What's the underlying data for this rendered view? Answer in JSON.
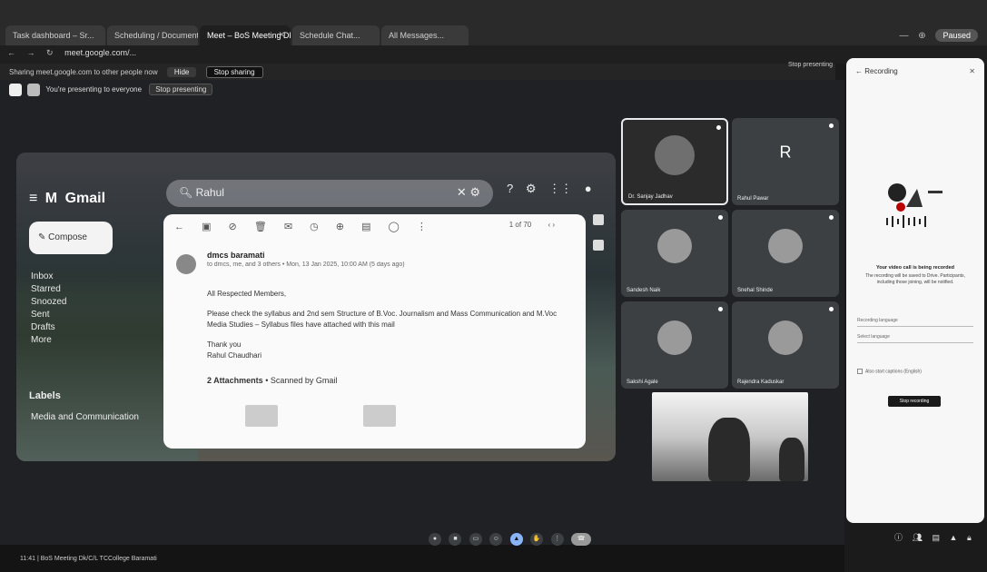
{
  "browser": {
    "tabs": [
      "Task dashboard – Sr...",
      "Scheduling / Documents...",
      "Meet – BoS Meeting Dk...",
      "Schedule Chat...",
      "All Messages..."
    ],
    "profile_label": "Paused",
    "url": "meet.google.com/..."
  },
  "sharebar": {
    "text": "Sharing meet.google.com to other people now",
    "stop_label": "Stop sharing",
    "hide_label": "Hide",
    "stop_presenting_label": "Stop presenting"
  },
  "meet": {
    "presenting_text": "You're presenting to everyone",
    "presenting_pill": "Stop presenting"
  },
  "gmail": {
    "logo": "Gmail",
    "search_value": "Rahul",
    "compose_label": "Compose",
    "nav": [
      "Inbox",
      "Starred",
      "Snoozed",
      "Sent",
      "Drafts",
      "More"
    ],
    "labels_heading": "Labels",
    "label_item": "Media and Communication",
    "pager": "1 of 70",
    "sender": "dmcs baramati",
    "sender_meta": "to dmcs, me, and 3 others • Mon, 13 Jan 2025, 10:00 AM (5 days ago)",
    "greeting": "All Respected Members,",
    "body_1": "Please check the syllabus and 2nd sem Structure of B.Voc. Journalism and Mass Communication and M.Voc Media Studies – Syllabus files have attached with this mail",
    "thanks": "Thank you",
    "signature": "Rahul Chaudhari",
    "attachments": "2 Attachments",
    "scanned": "Scanned by Gmail"
  },
  "participants": [
    {
      "name": "Dr. Sanjay Jadhav",
      "type": "video"
    },
    {
      "name": "Rahul Pawar",
      "type": "letter",
      "letter": "R"
    },
    {
      "name": "Sandesh Naik",
      "type": "avatar"
    },
    {
      "name": "Snehal Shinde",
      "type": "avatar"
    },
    {
      "name": "Sakshi Agale",
      "type": "avatar"
    },
    {
      "name": "Rajendra Kaduskar",
      "type": "avatar"
    }
  ],
  "bottom": {
    "meeting_info": "11:41 | BoS Meeting Dk/C/L TCCollege Baramati"
  },
  "recording_panel": {
    "title": "Recording",
    "heading": "Your video call is being recorded",
    "description": "The recording will be saved to Drive. Participants, including those joining, will be notified.",
    "field_1": "Recording language",
    "field_2": "Select language",
    "checkbox": "Also start captions (English)",
    "start_button": "Stop recording"
  },
  "colors": {
    "accent": "#8ab4f8",
    "stage_bg": "#202124",
    "tile_bg": "#3c4043"
  }
}
